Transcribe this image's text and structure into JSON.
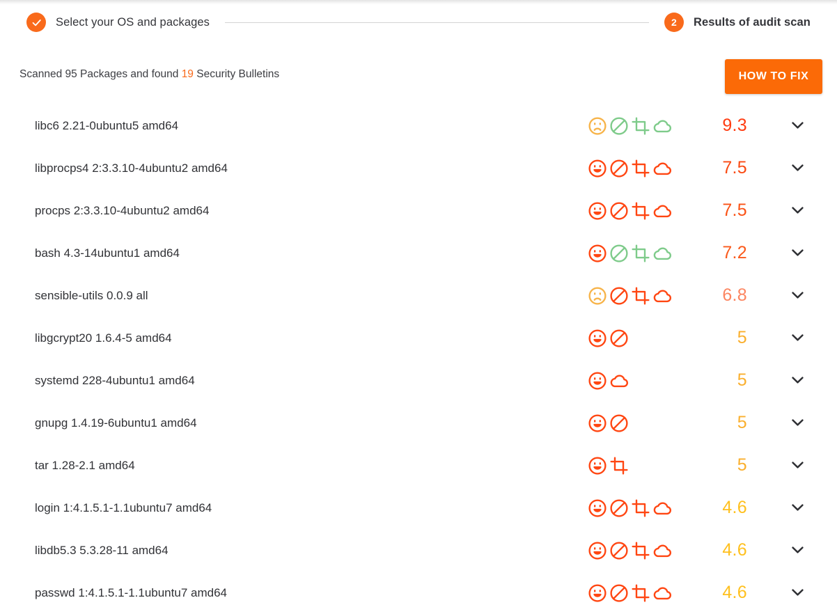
{
  "stepper": {
    "step1": {
      "label": "Select your OS and packages",
      "state": "completed",
      "icon": "check-icon"
    },
    "step2": {
      "label": "Results of audit scan",
      "badge": "2",
      "state": "active"
    }
  },
  "summary": {
    "prefix": "Scanned 95 Packages and found ",
    "count": "19",
    "suffix": " Security Bulletins",
    "full_text": "Scanned 95 Packages and found 19 Security Bulletins"
  },
  "actions": {
    "how_to_fix": "HOW TO FIX"
  },
  "colors": {
    "brand_orange": "#F96A1B",
    "button_orange": "#FB6A07",
    "severity_critical": "#FF3C11",
    "severity_high": "#FA5215",
    "severity_medium_high": "#FC7246",
    "severity_medium": "#FAAF2D",
    "severity_low": "#FFC01E",
    "icon_red": "#FF4612",
    "icon_green": "#7ECB8A",
    "icon_amber": "#F7B44A",
    "text_dark": "#313236",
    "rule_gray": "#d4d4d4"
  },
  "icon_legend": {
    "face": "face-severity-icon",
    "block": "blocked-circle-icon",
    "crop": "crop-frame-icon",
    "cloud": "cloud-icon"
  },
  "packages": [
    {
      "name": "libc6 2.21-0ubuntu5 amd64",
      "score": "9.3",
      "score_color": "#FF3C11",
      "icons": [
        {
          "type": "face",
          "expression": "sad",
          "color": "#F7B44A"
        },
        {
          "type": "block",
          "color": "#7ECB8A"
        },
        {
          "type": "crop",
          "color": "#7ECB8A"
        },
        {
          "type": "cloud",
          "color": "#7ECB8A"
        }
      ]
    },
    {
      "name": "libprocps4 2:3.3.10-4ubuntu2 amd64",
      "score": "7.5",
      "score_color": "#FA4A12",
      "icons": [
        {
          "type": "face",
          "expression": "happy",
          "color": "#FF4612"
        },
        {
          "type": "block",
          "color": "#FF4612"
        },
        {
          "type": "crop",
          "color": "#FF4612"
        },
        {
          "type": "cloud",
          "color": "#FF4612"
        }
      ]
    },
    {
      "name": "procps 2:3.3.10-4ubuntu2 amd64",
      "score": "7.5",
      "score_color": "#FA5215",
      "icons": [
        {
          "type": "face",
          "expression": "happy",
          "color": "#FF4612"
        },
        {
          "type": "block",
          "color": "#FF4612"
        },
        {
          "type": "crop",
          "color": "#FF4612"
        },
        {
          "type": "cloud",
          "color": "#FF4612"
        }
      ]
    },
    {
      "name": "bash 4.3-14ubuntu1 amd64",
      "score": "7.2",
      "score_color": "#FA5A1C",
      "icons": [
        {
          "type": "face",
          "expression": "happy",
          "color": "#FF4612"
        },
        {
          "type": "block",
          "color": "#7ECB8A"
        },
        {
          "type": "crop",
          "color": "#7ECB8A"
        },
        {
          "type": "cloud",
          "color": "#7ECB8A"
        }
      ]
    },
    {
      "name": "sensible-utils 0.0.9 all",
      "score": "6.8",
      "score_color": "#FC8560",
      "icons": [
        {
          "type": "face",
          "expression": "sad",
          "color": "#F7B44A"
        },
        {
          "type": "block",
          "color": "#FF4612"
        },
        {
          "type": "crop",
          "color": "#FF4612"
        },
        {
          "type": "cloud",
          "color": "#FF4612"
        }
      ]
    },
    {
      "name": "libgcrypt20 1.6.4-5 amd64",
      "score": "5",
      "score_color": "#FAAF2D",
      "icons": [
        {
          "type": "face",
          "expression": "happy",
          "color": "#FF4612"
        },
        {
          "type": "block",
          "color": "#FF4612"
        }
      ]
    },
    {
      "name": "systemd 228-4ubuntu1 amd64",
      "score": "5",
      "score_color": "#FAAF2D",
      "icons": [
        {
          "type": "face",
          "expression": "happy",
          "color": "#FF4612"
        },
        {
          "type": "cloud",
          "color": "#FF4612"
        }
      ]
    },
    {
      "name": "gnupg 1.4.19-6ubuntu1 amd64",
      "score": "5",
      "score_color": "#FAAF2D",
      "icons": [
        {
          "type": "face",
          "expression": "happy",
          "color": "#FF4612"
        },
        {
          "type": "block",
          "color": "#FF4612"
        }
      ]
    },
    {
      "name": "tar 1.28-2.1 amd64",
      "score": "5",
      "score_color": "#FAAF2D",
      "icons": [
        {
          "type": "face",
          "expression": "happy",
          "color": "#FF4612"
        },
        {
          "type": "crop",
          "color": "#FF4612"
        }
      ]
    },
    {
      "name": "login 1:4.1.5.1-1.1ubuntu7 amd64",
      "score": "4.6",
      "score_color": "#FFC01E",
      "icons": [
        {
          "type": "face",
          "expression": "happy",
          "color": "#FF4612"
        },
        {
          "type": "block",
          "color": "#FF4612"
        },
        {
          "type": "crop",
          "color": "#FF4612"
        },
        {
          "type": "cloud",
          "color": "#FF4612"
        }
      ]
    },
    {
      "name": "libdb5.3 5.3.28-11 amd64",
      "score": "4.6",
      "score_color": "#FFC01E",
      "icons": [
        {
          "type": "face",
          "expression": "happy",
          "color": "#FF4612"
        },
        {
          "type": "block",
          "color": "#FF4612"
        },
        {
          "type": "crop",
          "color": "#FF4612"
        },
        {
          "type": "cloud",
          "color": "#FF4612"
        }
      ]
    },
    {
      "name": "passwd 1:4.1.5.1-1.1ubuntu7 amd64",
      "score": "4.6",
      "score_color": "#FFC01E",
      "icons": [
        {
          "type": "face",
          "expression": "happy",
          "color": "#FF4612"
        },
        {
          "type": "block",
          "color": "#FF4612"
        },
        {
          "type": "crop",
          "color": "#FF4612"
        },
        {
          "type": "cloud",
          "color": "#FF4612"
        }
      ]
    }
  ]
}
